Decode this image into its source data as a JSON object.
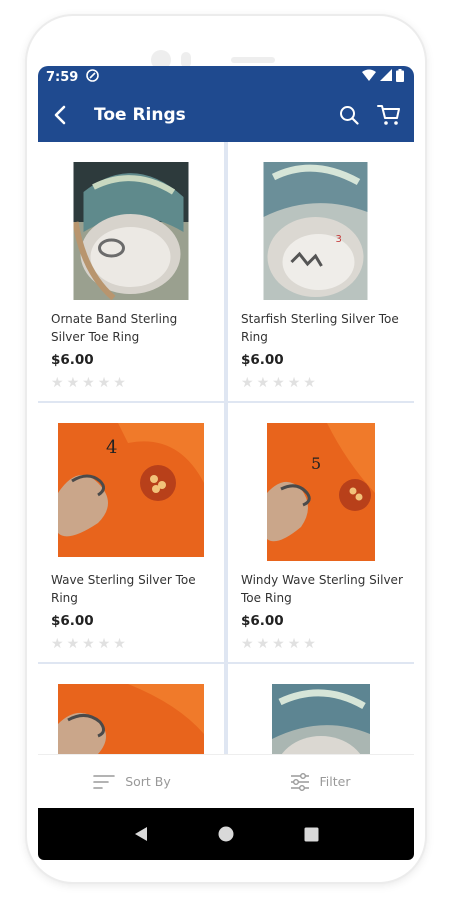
{
  "status": {
    "time": "7:59"
  },
  "header": {
    "title": "Toe Rings"
  },
  "products": [
    {
      "name": "Ornate Band Sterling Silver Toe Ring",
      "price": "$6.00",
      "image": "shell-photo"
    },
    {
      "name": "Starfish Sterling Silver Toe Ring",
      "price": "$6.00",
      "image": "shell-photo"
    },
    {
      "name": "Wave Sterling Silver Toe Ring",
      "price": "$6.00",
      "image": "flower-photo"
    },
    {
      "name": "Windy Wave Sterling Silver Toe Ring",
      "price": "$6.00",
      "image": "flower-photo"
    },
    {
      "name": "",
      "price": "",
      "image": "flower-photo"
    },
    {
      "name": "",
      "price": "",
      "image": "shell-photo"
    }
  ],
  "rating_stars": 5,
  "bottom": {
    "sort_label": "Sort By",
    "filter_label": "Filter"
  },
  "colors": {
    "primary": "#1f4a8f",
    "flower": "#e8641c",
    "star": "#e1e1e1"
  }
}
